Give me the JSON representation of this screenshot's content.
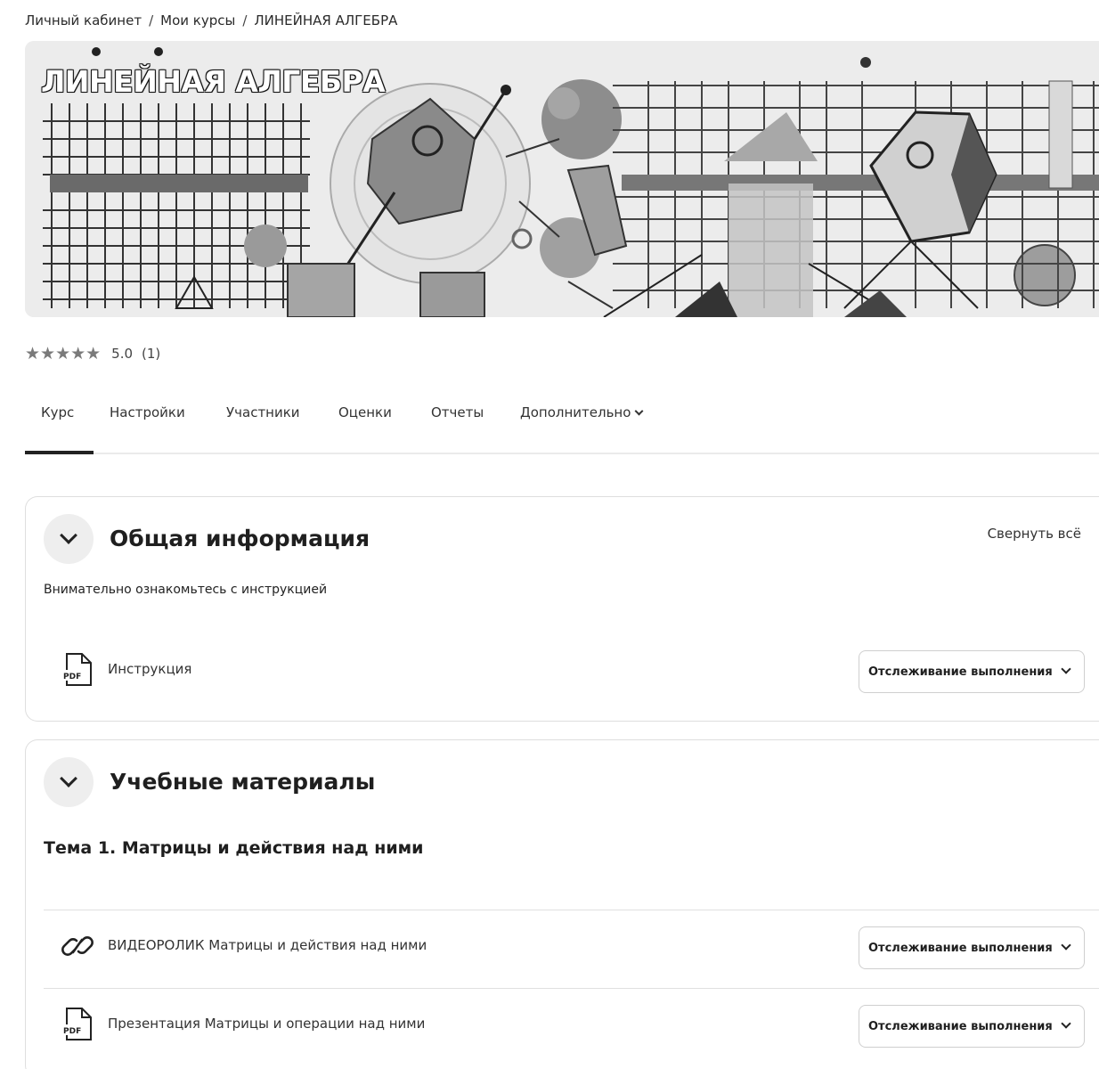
{
  "breadcrumb": {
    "items": [
      "Личный кабинет",
      "Мои курсы",
      "ЛИНЕЙНАЯ АЛГЕБРА"
    ],
    "separator": "/"
  },
  "banner": {
    "title": "ЛИНЕЙНАЯ АЛГЕБРА"
  },
  "rating": {
    "stars": "★★★★★",
    "score": "5.0",
    "count": "(1)"
  },
  "tabs": [
    {
      "label": "Курс",
      "active": true
    },
    {
      "label": "Настройки"
    },
    {
      "label": "Участники"
    },
    {
      "label": "Оценки"
    },
    {
      "label": "Отчеты"
    },
    {
      "label": "Дополнительно"
    }
  ],
  "sections": [
    {
      "title": "Общая информация",
      "collapse_all": "Свернуть всё",
      "description": "Внимательно ознакомьтесь с инструкцией",
      "activities": [
        {
          "icon": "pdf-icon",
          "label": "Инструкция",
          "completion": "Отслеживание выполнения"
        }
      ]
    },
    {
      "title": "Учебные материалы",
      "topic": "Тема 1. Матрицы и действия над ними",
      "activities": [
        {
          "icon": "link-icon",
          "label": "ВИДЕОРОЛИК Матрицы и действия над ними",
          "completion": "Отслеживание выполнения"
        },
        {
          "icon": "pdf-icon",
          "label": "Презентация Матрицы и операции над ними",
          "completion": "Отслеживание выполнения"
        }
      ]
    }
  ],
  "icons": {
    "pdf_text": "PDF"
  }
}
